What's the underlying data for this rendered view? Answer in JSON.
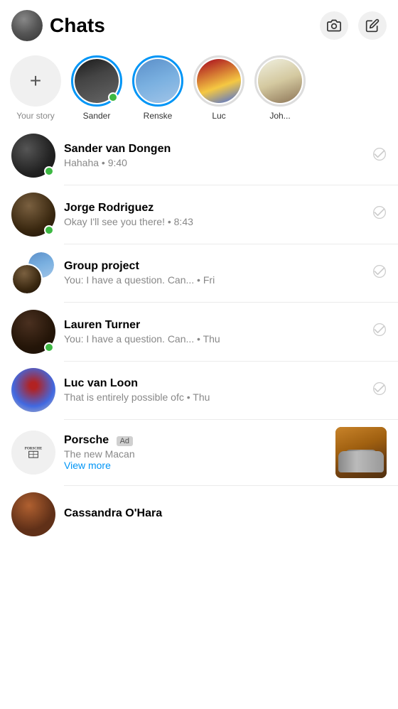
{
  "header": {
    "title": "Chats",
    "camera_label": "📷",
    "compose_label": "✏️"
  },
  "stories": {
    "add_label": "+",
    "your_story_label": "Your story",
    "items": [
      {
        "id": "sander",
        "name": "Sander",
        "online": true,
        "ring": true
      },
      {
        "id": "renske",
        "name": "Renske",
        "online": false,
        "ring": true
      },
      {
        "id": "luc",
        "name": "Luc",
        "online": false,
        "ring": false
      },
      {
        "id": "john",
        "name": "Joh...",
        "online": false,
        "ring": false
      }
    ]
  },
  "chats": [
    {
      "id": "sander",
      "name": "Sander van Dongen",
      "preview": "Hahaha • 9:40",
      "online": true,
      "type": "single"
    },
    {
      "id": "jorge",
      "name": "Jorge Rodriguez",
      "preview": "Okay I'll see you there! • 8:43",
      "online": true,
      "type": "single"
    },
    {
      "id": "group",
      "name": "Group project",
      "preview": "You: I have a question. Can... • Fri",
      "online": false,
      "type": "group"
    },
    {
      "id": "lauren",
      "name": "Lauren Turner",
      "preview": "You: I have a question. Can... • Thu",
      "online": true,
      "type": "single"
    },
    {
      "id": "luc",
      "name": "Luc van Loon",
      "preview": "That is entirely possible ofc • Thu",
      "online": false,
      "type": "single"
    },
    {
      "id": "porsche",
      "name": "Porsche",
      "ad": true,
      "preview": "The new Macan",
      "view_more": "View more",
      "type": "ad"
    },
    {
      "id": "cassandra",
      "name": "Cassandra O'Hara",
      "preview": "",
      "online": false,
      "type": "single"
    }
  ],
  "icons": {
    "check": "✓",
    "camera": "⊙",
    "compose": "✎",
    "ad_label": "Ad"
  }
}
